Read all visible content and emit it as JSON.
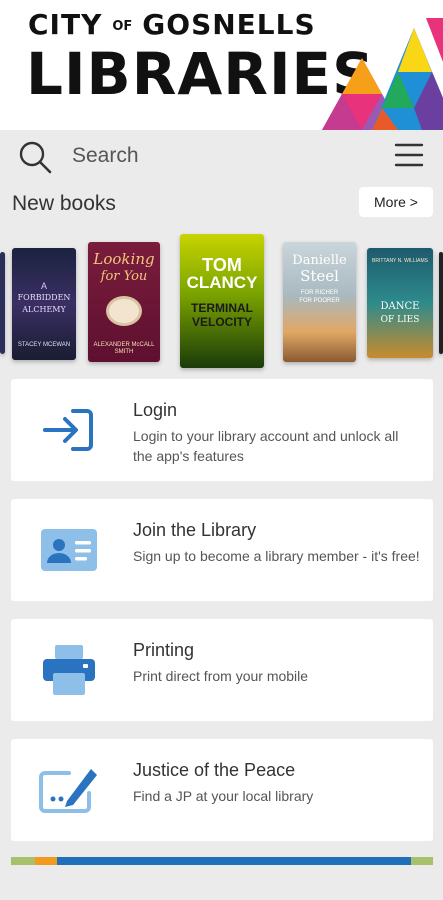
{
  "header": {
    "logo_line1_city": "CITY",
    "logo_line1_of": "OF",
    "logo_line1_name": "GOSNELLS",
    "logo_line2": "LIBRARIES"
  },
  "search": {
    "label": "Search"
  },
  "new_books": {
    "title": "New books",
    "more_label": "More >",
    "books": [
      {
        "title_lines": [
          "A",
          "FORBIDDEN",
          "ALCHEMY"
        ],
        "author": "STACEY MCEWAN"
      },
      {
        "title_lines": [
          "Looking",
          "for You"
        ],
        "author": "ALEXANDER McCALL SMITH"
      },
      {
        "title_lines": [
          "TOM",
          "CLANCY",
          "TERMINAL",
          "VELOCITY"
        ],
        "author": ""
      },
      {
        "title_lines": [
          "Danielle",
          "Steel",
          "FOR RICHER",
          "FOR POORER"
        ],
        "author": ""
      },
      {
        "title_lines": [
          "DANCE",
          "OF LIES"
        ],
        "author": "BRITTANY N. WILLIAMS"
      }
    ]
  },
  "menu_cards": [
    {
      "title": "Login",
      "description": "Login to your library account and unlock all the app's features"
    },
    {
      "title": "Join the Library",
      "description": "Sign up to become a library member - it's free!"
    },
    {
      "title": "Printing",
      "description": "Print direct from your mobile"
    },
    {
      "title": "Justice of the Peace",
      "description": "Find a JP at your local library"
    }
  ],
  "colors": {
    "accent_blue": "#1f6fba",
    "icon_blue": "#2a73c0",
    "icon_light_blue": "#8dbfe8",
    "background": "#ebebeb"
  }
}
